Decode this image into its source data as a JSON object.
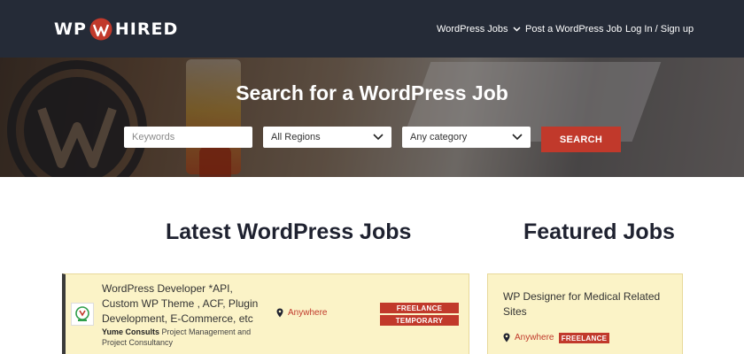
{
  "header": {
    "logo_left": "WP",
    "logo_right": "HIRED",
    "nav": {
      "jobs": "WordPress Jobs",
      "post": "Post a WordPress Job",
      "login": "Log In / Sign up"
    }
  },
  "hero": {
    "title": "Search for a WordPress Job",
    "keywords_placeholder": "Keywords",
    "region_value": "All Regions",
    "category_value": "Any category",
    "search_label": "SEARCH"
  },
  "sections": {
    "latest_title": "Latest WordPress Jobs",
    "featured_title": "Featured Jobs"
  },
  "latest_jobs": [
    {
      "title": "WordPress Developer *API, Custom WP Theme , ACF, Plugin Development, E-Commerce, etc",
      "company": "Yume Consults",
      "tagline": "Project Management and Project Consultancy",
      "location": "Anywhere",
      "types": [
        "FREELANCE",
        "TEMPORARY"
      ]
    }
  ],
  "featured_jobs": [
    {
      "title": "WP Designer for Medical Related Sites",
      "location": "Anywhere",
      "type": "FREELANCE"
    }
  ],
  "colors": {
    "header_bg": "#252b37",
    "accent": "#c1392b",
    "card_bg": "#fbf3c7"
  },
  "icons": [
    "wordpress-logo-icon",
    "chevron-down-icon",
    "map-pin-icon",
    "company-logo-icon"
  ]
}
